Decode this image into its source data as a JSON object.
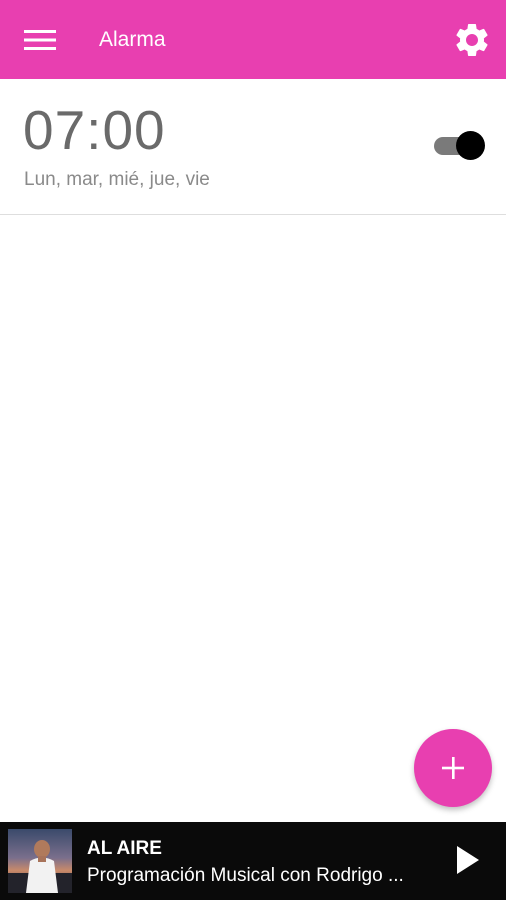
{
  "toolbar": {
    "title": "Alarma",
    "menu_icon": "hamburger-menu-icon",
    "settings_icon": "gear-icon",
    "color": "#e83fb0"
  },
  "alarms": [
    {
      "time": "07:00",
      "days": "Lun, mar, mié, jue, vie",
      "enabled": true
    }
  ],
  "fab": {
    "icon": "plus-icon",
    "color": "#e83fb0"
  },
  "player": {
    "title": "AL AIRE",
    "subtitle": "Programación Musical con Rodrigo ...",
    "play_icon": "play-icon",
    "thumbnail": "person-photo-thumbnail"
  }
}
